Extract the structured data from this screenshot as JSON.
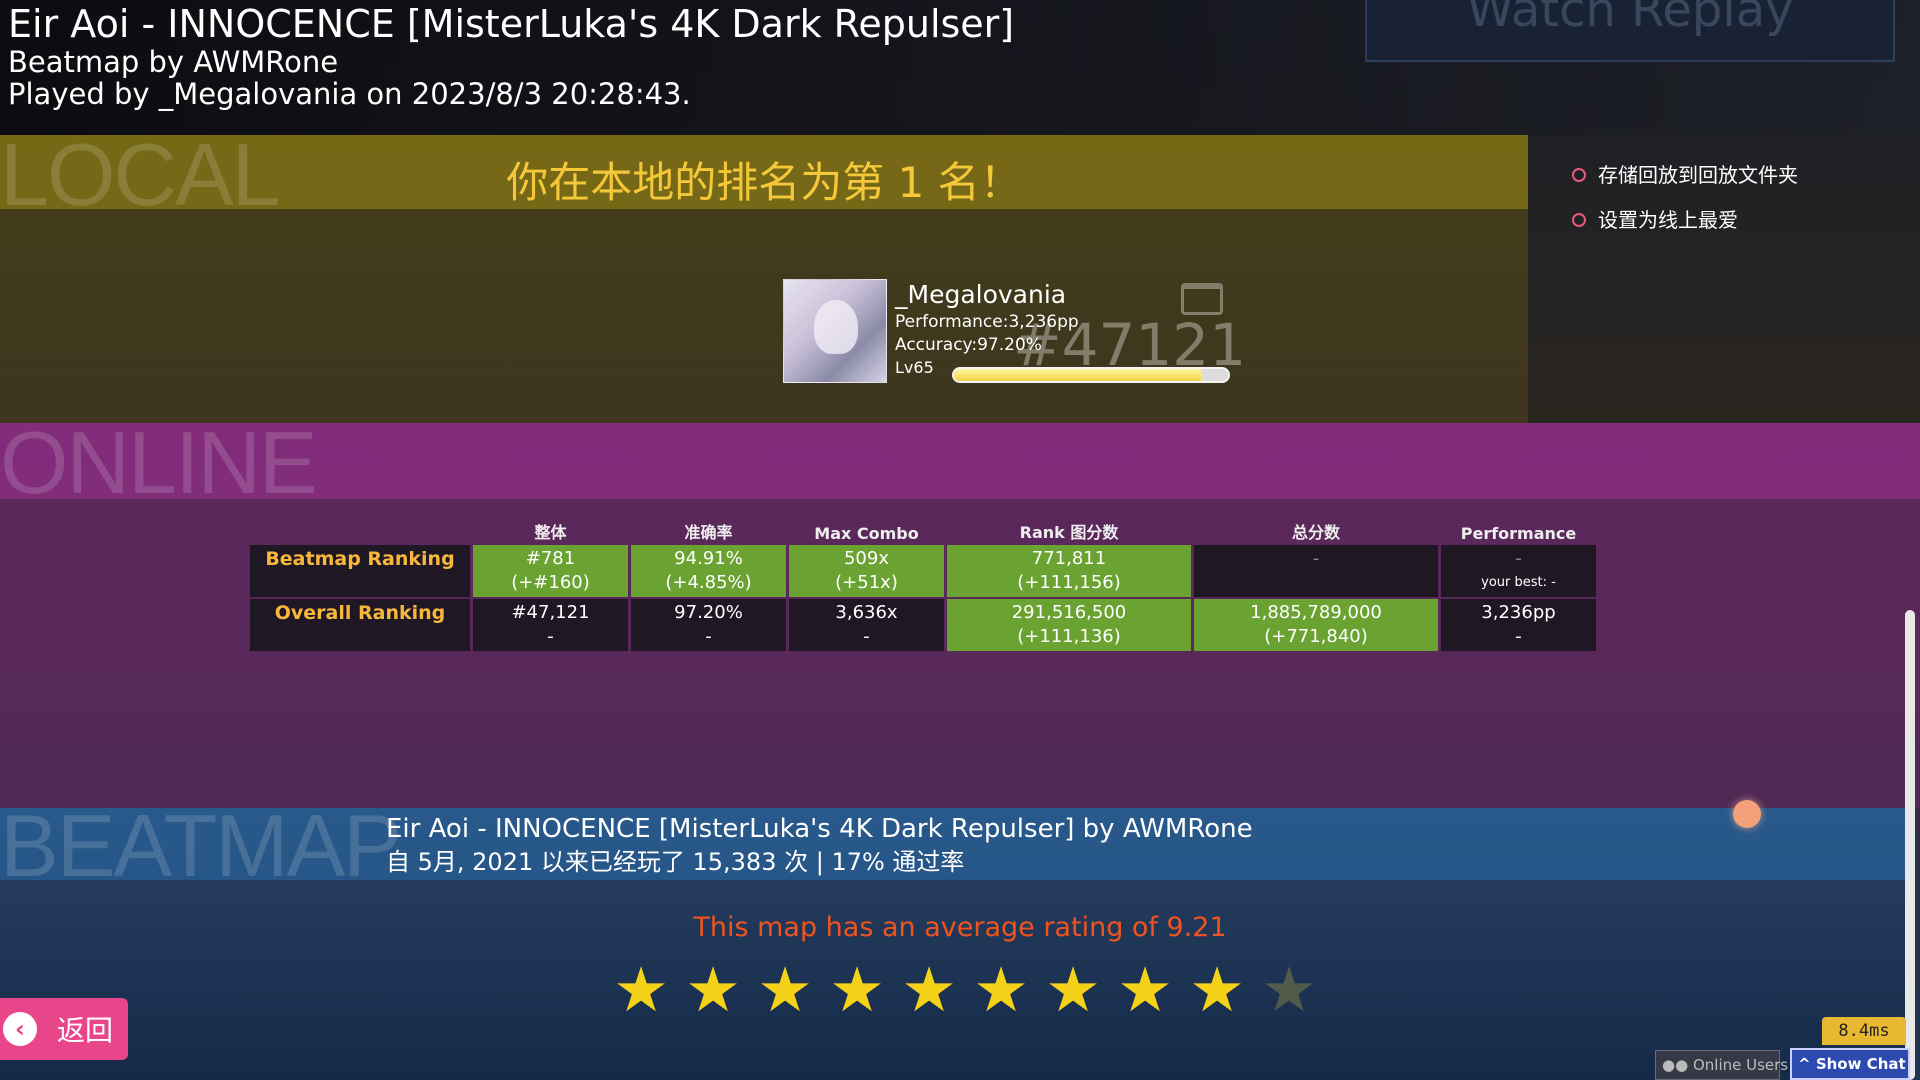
{
  "header": {
    "title": "Eir Aoi - INNOCENCE [MisterLuka's 4K Dark Repulser]",
    "mapper": "Beatmap by AWMRone",
    "played_by": "Played by _Megalovania on 2023/8/3 20:28:43.",
    "watch_replay": "Watch Replay"
  },
  "local": {
    "section_label": "LOCAL",
    "rank_message": "你在本地的排名为第 1 名！",
    "player": {
      "name": "_Megalovania",
      "performance": "Performance:3,236pp",
      "accuracy": "Accuracy:97.20%",
      "level": "Lv65",
      "level_progress": 0.9,
      "global_rank": "#47121"
    }
  },
  "side_menu": {
    "save_replay": "存储回放到回放文件夹",
    "set_favourite": "设置为线上最爱"
  },
  "online": {
    "section_label": "ONLINE",
    "columns": [
      "整体",
      "准确率",
      "Max Combo",
      "Rank 图分数",
      "总分数",
      "Performance"
    ],
    "beatmap_ranking": {
      "label": "Beatmap Ranking",
      "overall": "#781",
      "overall_delta": "(+#160)",
      "accuracy": "94.91%",
      "accuracy_delta": "(+4.85%)",
      "combo": "509x",
      "combo_delta": "(+51x)",
      "ranked_score": "771,811",
      "ranked_score_delta": "(+111,156)",
      "total_score": "-",
      "performance": "-",
      "your_best": "your best: -"
    },
    "overall_ranking": {
      "label": "Overall Ranking",
      "overall": "#47,121",
      "overall_delta": "-",
      "accuracy": "97.20%",
      "accuracy_delta": "-",
      "combo": "3,636x",
      "combo_delta": "-",
      "ranked_score": "291,516,500",
      "ranked_score_delta": "(+111,136)",
      "total_score": "1,885,789,000",
      "total_score_delta": "(+771,840)",
      "performance": "3,236pp",
      "performance_delta": "-"
    }
  },
  "beatmap": {
    "section_label": "BEATMAP",
    "title": "Eir Aoi - INNOCENCE [MisterLuka's 4K Dark Repulser] by AWMRone",
    "played_info": "自 5月, 2021 以来已经玩了 15,383 次 | 17% 通过率",
    "rating_text": "This map has an average rating of 9.21",
    "rating": 9.21,
    "max_stars": 10
  },
  "controls": {
    "back": "返回",
    "latency": "8.4ms",
    "online_users": "Online Users",
    "show_chat": "Show Chat"
  },
  "colors": {
    "accent_green": "#6aa331",
    "rank_label": "#f7b73b",
    "rating_text": "#f0541e",
    "star": "#f5d21a",
    "back_button": "#e8458a"
  }
}
